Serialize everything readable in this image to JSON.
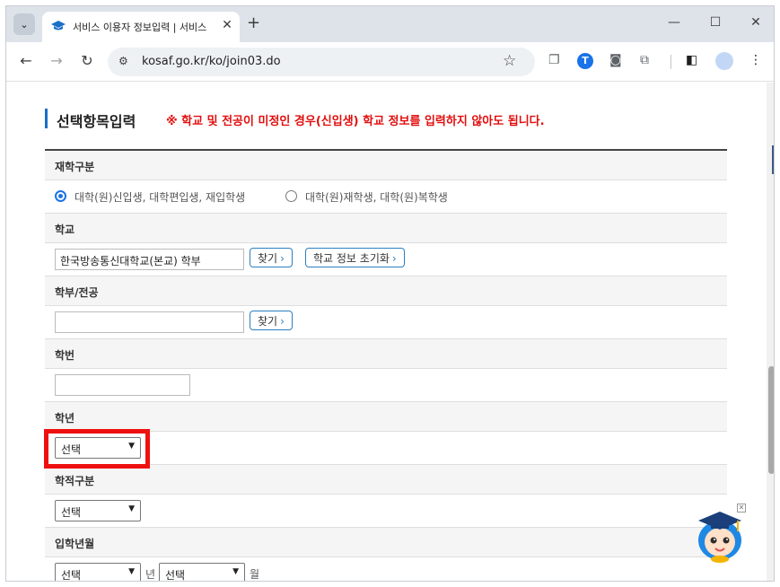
{
  "browser": {
    "tab_title": "서비스 이용자 정보입력 | 서비스 이용",
    "new_tab": "+",
    "url": "kosaf.go.kr/ko/join03.do",
    "extension_letter": "T"
  },
  "section": {
    "title": "선택항목입력",
    "note": "※ 학교 및 전공이 미정인 경우(신입생) 학교 정보를 입력하지 않아도 됩니다."
  },
  "form": {
    "enrollment_type": {
      "label": "재학구분",
      "option1": "대학(원)신입생, 대학편입생, 재입학생",
      "option2": "대학(원)재학생, 대학(원)복학생",
      "selected": "option1"
    },
    "school": {
      "label": "학교",
      "value": "한국방송통신대학교(본교) 학부",
      "find_button": "찾기",
      "reset_button": "학교 정보 초기화"
    },
    "department": {
      "label": "학부/전공",
      "value": "",
      "find_button": "찾기"
    },
    "student_id": {
      "label": "학번",
      "value": ""
    },
    "grade": {
      "label": "학년",
      "selected": "선택"
    },
    "academic_status": {
      "label": "학적구분",
      "selected": "선택"
    },
    "admission_date": {
      "label": "입학년월",
      "year_selected": "선택",
      "year_suffix": "년",
      "month_selected": "선택",
      "month_suffix": "월"
    }
  },
  "icons": {
    "tab_favicon": "graduation-cap-icon",
    "mascot": "mascot-chatbot-icon"
  },
  "colors": {
    "accent": "#1b6fc6",
    "note_red": "#e20e0e",
    "highlight_red": "#ee1010"
  }
}
